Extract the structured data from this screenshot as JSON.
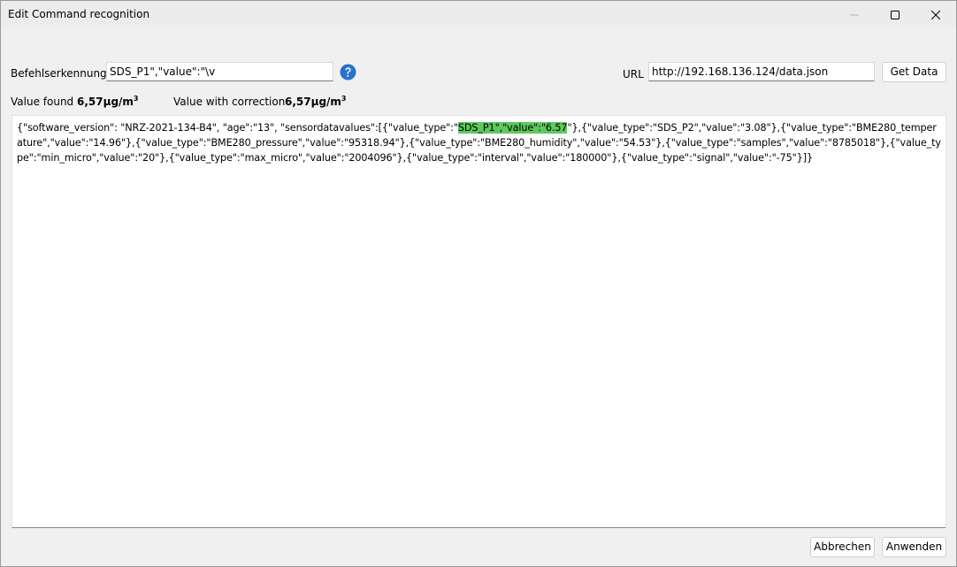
{
  "window": {
    "title": "Edit Command recognition"
  },
  "form": {
    "command_label": "Befehlserkennung",
    "command_value": "SDS_P1\",\"value\":\"\\v",
    "url_label": "URL",
    "url_value": "http://192.168.136.124/data.json",
    "get_data_label": "Get Data",
    "value_found_label": "Value found",
    "value_found": "6,57µg/m",
    "value_found_sup": "3",
    "value_correction_label": "Value with correction",
    "value_correction": "6,57µg/m",
    "value_correction_sup": "3"
  },
  "json": {
    "before": "{\"software_version\": \"NRZ-2021-134-B4\", \"age\":\"13\", \"sensordatavalues\":[{\"value_type\":\"",
    "highlight": "SDS_P1\",\"value\":\"6.57",
    "after": "\"},{\"value_type\":\"SDS_P2\",\"value\":\"3.08\"},{\"value_type\":\"BME280_temperature\",\"value\":\"14.96\"},{\"value_type\":\"BME280_pressure\",\"value\":\"95318.94\"},{\"value_type\":\"BME280_humidity\",\"value\":\"54.53\"},{\"value_type\":\"samples\",\"value\":\"8785018\"},{\"value_type\":\"min_micro\",\"value\":\"20\"},{\"value_type\":\"max_micro\",\"value\":\"2004096\"},{\"value_type\":\"interval\",\"value\":\"180000\"},{\"value_type\":\"signal\",\"value\":\"-75\"}]}",
    "highlight_color": "#5ec85e"
  },
  "footer": {
    "cancel_label": "Abbrechen",
    "apply_label": "Anwenden"
  },
  "icons": {
    "help": "help-icon",
    "minimize": "minimize-icon",
    "maximize": "maximize-icon",
    "close": "close-icon"
  }
}
